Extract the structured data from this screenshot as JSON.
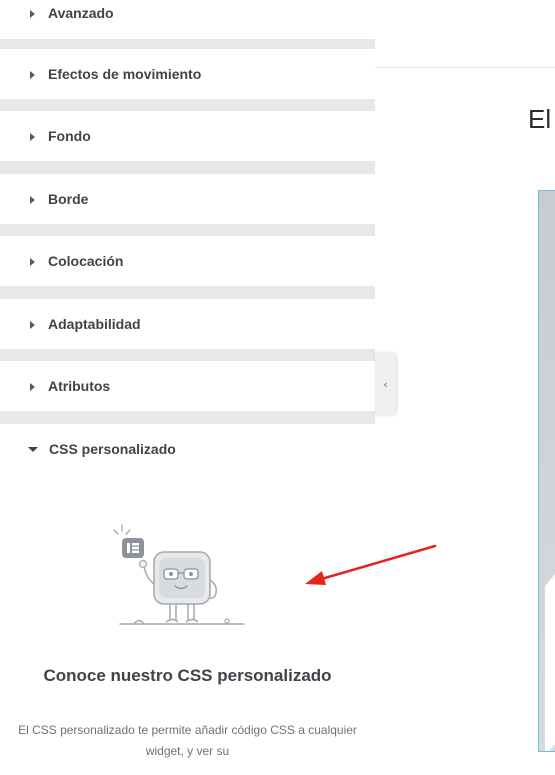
{
  "panel": {
    "sections": [
      {
        "label": "Avanzado",
        "expanded": false
      },
      {
        "label": "Efectos de movimiento",
        "expanded": false
      },
      {
        "label": "Fondo",
        "expanded": false
      },
      {
        "label": "Borde",
        "expanded": false
      },
      {
        "label": "Colocación",
        "expanded": false
      },
      {
        "label": "Adaptabilidad",
        "expanded": false
      },
      {
        "label": "Atributos",
        "expanded": false
      },
      {
        "label": "CSS personalizado",
        "expanded": true
      }
    ],
    "promo": {
      "title": "Conoce nuestro CSS personalizado",
      "text": "El CSS personalizado te permite añadir código CSS a cualquier widget, y ver su"
    },
    "collapse_icon": "chevron-left-icon"
  },
  "preview": {
    "heading": "El"
  },
  "colors": {
    "panel_background": "#e6e8ea",
    "section_background": "#ffffff",
    "text": "#3f444b",
    "annotation_arrow": "#e8231c",
    "preview_border": "#6ec1e4"
  }
}
